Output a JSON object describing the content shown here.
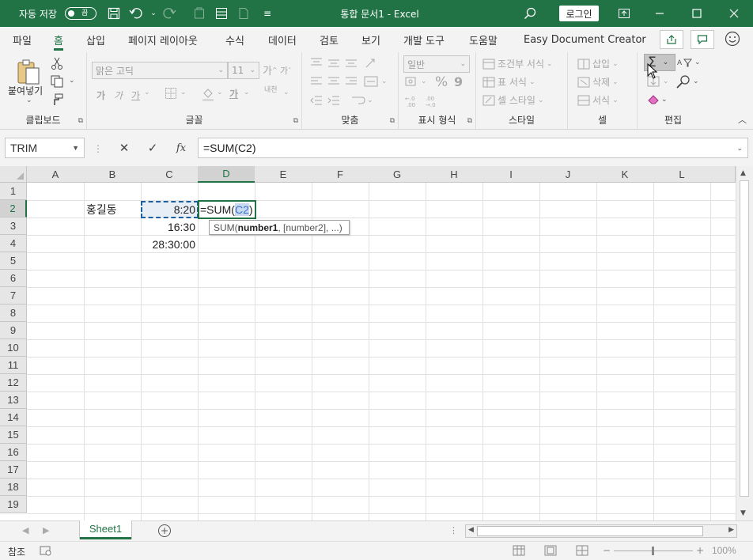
{
  "titlebar": {
    "autosave_label": "자동 저장",
    "autosave_state": "끔",
    "document_title": "통합 문서1  -  Excel",
    "login_label": "로그인",
    "icons": [
      "save-icon",
      "undo-icon",
      "redo-icon",
      "customize-icon",
      "search-icon",
      "ribbon-display-icon",
      "minimize-icon",
      "maximize-icon",
      "close-icon"
    ]
  },
  "tabs": [
    "파일",
    "홈",
    "삽입",
    "페이지 레이아웃",
    "수식",
    "데이터",
    "검토",
    "보기",
    "개발 도구",
    "도움말",
    "Easy Document Creator"
  ],
  "active_tab": "홈",
  "ribbon": {
    "clipboard": {
      "label": "클립보드",
      "paste_label": "붙여넣기"
    },
    "font": {
      "label": "글꼴",
      "font_name": "맑은 고딕",
      "font_size": "11",
      "grow": "가",
      "shrink": "가",
      "bold": "가",
      "italic": "가",
      "underline": "가",
      "font_color": "가",
      "phonetic": "내천"
    },
    "alignment": {
      "label": "맞춤"
    },
    "number": {
      "label": "표시 형식",
      "format": "일반",
      "percent": "%",
      "comma": "9"
    },
    "styles": {
      "label": "스타일",
      "conditional": "조건부 서식",
      "table": "표 서식",
      "cell_style": "셀 스타일"
    },
    "cells": {
      "label": "셀",
      "insert": "삽입",
      "delete": "삭제",
      "format": "서식"
    },
    "editing": {
      "label": "편집",
      "sum_symbol": "Σ"
    }
  },
  "formula_bar": {
    "name_box": "TRIM",
    "cancel": "✕",
    "enter": "✓",
    "fx": "fx",
    "formula": "=SUM(C2)"
  },
  "grid": {
    "columns": [
      "A",
      "B",
      "C",
      "D",
      "E",
      "F",
      "G",
      "H",
      "I",
      "J",
      "K",
      "L"
    ],
    "rows": [
      "1",
      "2",
      "3",
      "4",
      "5",
      "6",
      "7",
      "8",
      "9",
      "10",
      "11",
      "12",
      "13",
      "14",
      "15",
      "16",
      "17",
      "18",
      "19"
    ],
    "selected_column": "D",
    "selected_row": "2",
    "cells": {
      "B2": "홍길동",
      "C2": "8:20",
      "C3": "16:30",
      "C4": "28:30:00",
      "D2_prefix": "=SUM(",
      "D2_ref": "C2",
      "D2_suffix": ")"
    },
    "tooltip": {
      "func": "SUM(",
      "arg1": "number1",
      "rest": ", [number2], ...)"
    }
  },
  "sheets": {
    "tabs": [
      "Sheet1"
    ],
    "active": "Sheet1",
    "add_label": "+"
  },
  "statusbar": {
    "mode": "참조",
    "zoom": "100%"
  },
  "colors": {
    "accent": "#217346",
    "reference": "#3a74c8"
  }
}
